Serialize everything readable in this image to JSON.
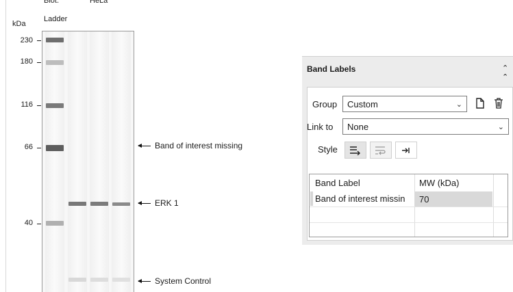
{
  "gel": {
    "unit": "kDa",
    "lane_headers": [
      "Biot.\nLadder",
      "HeLa"
    ],
    "ladder_marks": [
      {
        "label": "230"
      },
      {
        "label": "180"
      },
      {
        "label": "116"
      },
      {
        "label": "66"
      },
      {
        "label": "40"
      }
    ],
    "annotations": [
      {
        "text": "Band of interest missing"
      },
      {
        "text": "ERK 1"
      },
      {
        "text": "System Control"
      }
    ]
  },
  "panel": {
    "title": "Band Labels",
    "collapse_icon": "double-chevron-up-icon",
    "group_label": "Group",
    "group_value": "Custom",
    "link_label": "Link to",
    "link_value": "None",
    "style_label": "Style",
    "table": {
      "headers": [
        "Band Label",
        "MW (kDa)"
      ],
      "rows": [
        {
          "label": "Band of interest missin",
          "mw": "70"
        }
      ]
    }
  }
}
